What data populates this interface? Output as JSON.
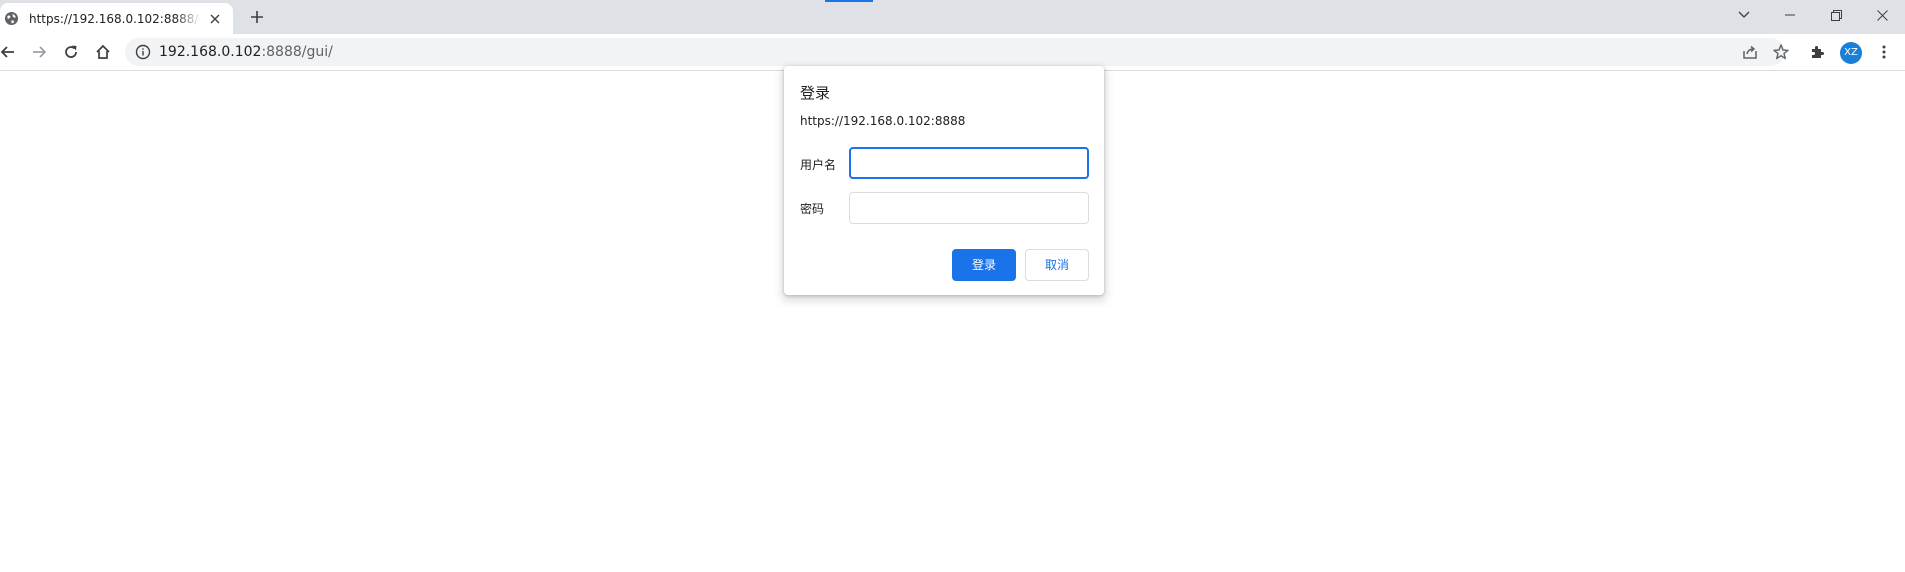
{
  "browser": {
    "tab": {
      "title": "https://192.168.0.102:8888/gui/",
      "favicon": "globe-icon"
    },
    "new_tab_icon": "plus-icon",
    "window_controls": [
      "chevron-down-icon",
      "minimize-icon",
      "restore-icon",
      "close-icon"
    ],
    "toolbar": {
      "buttons": [
        "back-arrow-icon",
        "forward-arrow-icon",
        "reload-icon",
        "home-icon"
      ],
      "url_host": "192.168.0.102",
      "url_rest": ":8888/gui/",
      "site_info_icon": "info-icon",
      "right_icons": [
        "share-icon",
        "star-icon",
        "extensions-icon",
        "more-vert-icon"
      ],
      "profile_initials": "XZ",
      "profile_color": "#1a7fd6"
    },
    "accent_color": "#1a73e8"
  },
  "dialog": {
    "title": "登录",
    "origin": "https://192.168.0.102:8888",
    "username_label": "用户名",
    "username_value": "",
    "password_label": "密码",
    "password_value": "",
    "sign_in_label": "登录",
    "cancel_label": "取消"
  }
}
